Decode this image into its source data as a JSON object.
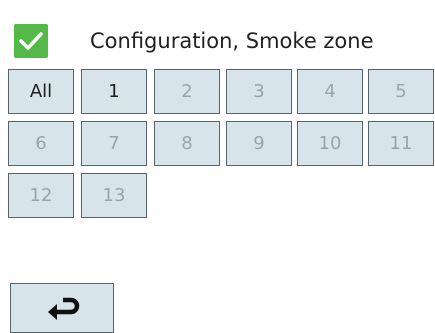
{
  "header": {
    "title": "Configuration, Smoke zone",
    "check_icon": "checkmark-icon",
    "check_color": "#54b948"
  },
  "zone_buttons": [
    {
      "label": "All",
      "active": true
    },
    {
      "label": "1",
      "active": true
    },
    {
      "label": "2",
      "active": false
    },
    {
      "label": "3",
      "active": false
    },
    {
      "label": "4",
      "active": false
    },
    {
      "label": "5",
      "active": false
    },
    {
      "label": "6",
      "active": false
    },
    {
      "label": "7",
      "active": false
    },
    {
      "label": "8",
      "active": false
    },
    {
      "label": "9",
      "active": false
    },
    {
      "label": "10",
      "active": false
    },
    {
      "label": "11",
      "active": false
    },
    {
      "label": "12",
      "active": false
    },
    {
      "label": "13",
      "active": false
    }
  ],
  "footer": {
    "back_icon": "return-arrow-icon"
  },
  "colors": {
    "button_bg": "#d7e5ea",
    "button_border": "#56646b",
    "active_text": "#1c1c1c",
    "inactive_text": "#9aa5aa"
  }
}
